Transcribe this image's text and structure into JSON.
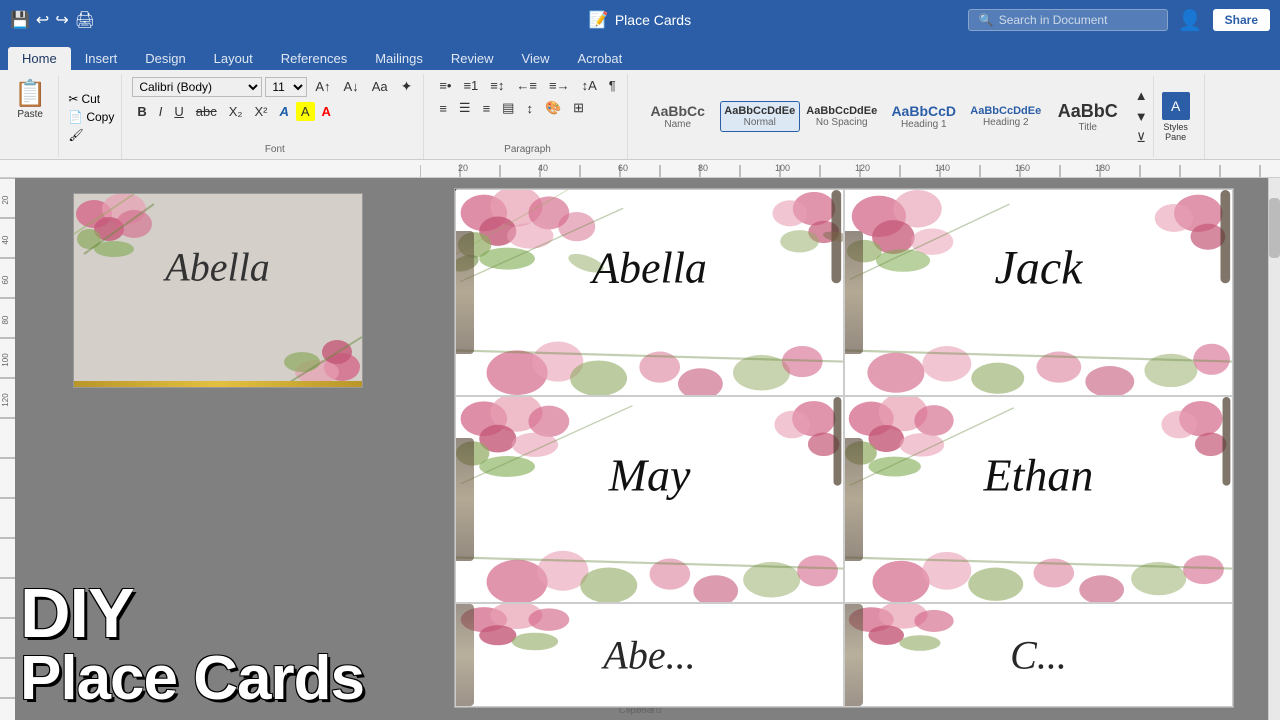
{
  "titleBar": {
    "title": "Place Cards",
    "icon": "📄",
    "searchPlaceholder": "Search in Document",
    "profileIcon": "👤",
    "shareLabel": "Share"
  },
  "ribbonTabs": [
    {
      "id": "home",
      "label": "Home",
      "active": true
    },
    {
      "id": "insert",
      "label": "Insert",
      "active": false
    },
    {
      "id": "design",
      "label": "Design",
      "active": false
    },
    {
      "id": "layout",
      "label": "Layout",
      "active": false
    },
    {
      "id": "references",
      "label": "References",
      "active": false
    },
    {
      "id": "mailings",
      "label": "Mailings",
      "active": false
    },
    {
      "id": "review",
      "label": "Review",
      "active": false
    },
    {
      "id": "view",
      "label": "View",
      "active": false
    },
    {
      "id": "acrobat",
      "label": "Acrobat",
      "active": false
    }
  ],
  "ribbon": {
    "pasteLabel": "Paste",
    "fontFamily": "Calibri (Body)",
    "fontSize": "11",
    "styles": [
      {
        "id": "name",
        "label": "Name",
        "preview": "AaBbCc",
        "active": false
      },
      {
        "id": "normal",
        "label": "Normal",
        "preview": "AaBbCcDdEe",
        "active": true
      },
      {
        "id": "no-spacing",
        "label": "No Spacing",
        "preview": "AaBbCcDdEe",
        "active": false
      },
      {
        "id": "heading1",
        "label": "Heading 1",
        "preview": "AaBbCcD",
        "active": false
      },
      {
        "id": "heading2",
        "label": "Heading 2",
        "preview": "AaBbCcDdEe",
        "active": false
      },
      {
        "id": "title",
        "label": "Title",
        "preview": "AaBbC",
        "active": false
      }
    ],
    "stylesPaneLabel": "Styles\nPane"
  },
  "cards": [
    {
      "id": "abella",
      "name": "Abella",
      "position": "top-left"
    },
    {
      "id": "jack",
      "name": "Jack",
      "position": "top-right"
    },
    {
      "id": "may",
      "name": "May",
      "position": "bottom-left"
    },
    {
      "id": "ethan",
      "name": "Ethan",
      "position": "bottom-right"
    }
  ],
  "sidebar": {
    "previewName": "Abella",
    "diyLine1": "DIY",
    "diyLine2": "Place Cards"
  }
}
